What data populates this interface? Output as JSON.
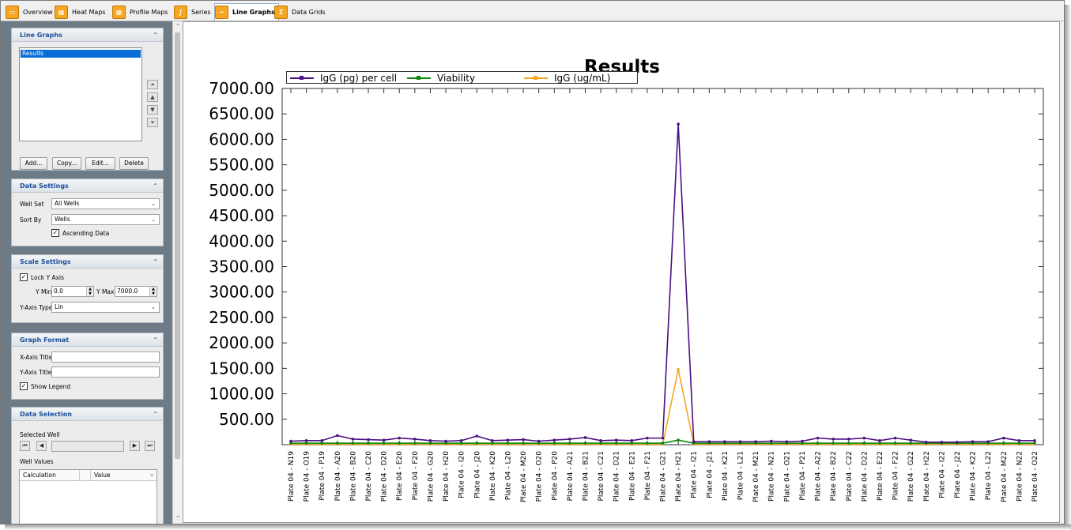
{
  "tabs": [
    {
      "id": "overview",
      "label": "Overview",
      "icon": "overview-icon",
      "glyph": "▭",
      "left": 6
    },
    {
      "id": "heat-maps",
      "label": "Heat Maps",
      "icon": "heat-map-icon",
      "glyph": "▦",
      "left": 68
    },
    {
      "id": "profile-maps",
      "label": "Profile Maps",
      "icon": "profile-map-icon",
      "glyph": "▦",
      "left": 141
    },
    {
      "id": "series",
      "label": "Series",
      "icon": "series-icon",
      "glyph": "∫",
      "left": 219
    },
    {
      "id": "line-graphs",
      "label": "Line Graphs",
      "icon": "line-graph-icon",
      "glyph": "~",
      "left": 270,
      "active": true
    },
    {
      "id": "data-grids",
      "label": "Data Grids",
      "icon": "data-grid-icon",
      "glyph": "Σ",
      "left": 346
    }
  ],
  "line_graphs": {
    "header": "Line Graphs",
    "items": [
      "Results"
    ],
    "add_label": "Add...",
    "copy_label": "Copy...",
    "edit_label": "Edit...",
    "delete_label": "Delete"
  },
  "data_settings": {
    "header": "Data Settings",
    "well_set_label": "Well Set",
    "well_set_value": "All Wells",
    "sort_by_label": "Sort By",
    "sort_by_value": "Wells",
    "ascending_label": "Ascending Data",
    "ascending_checked": true
  },
  "scale_settings": {
    "header": "Scale Settings",
    "lock_y_label": "Lock Y Axis",
    "lock_y_checked": true,
    "y_min_label": "Y Min",
    "y_min_value": "0.0",
    "y_max_label": "Y Max",
    "y_max_value": "7000.0",
    "y_axis_type_label": "Y-Axis Type",
    "y_axis_type_value": "Lin"
  },
  "graph_format": {
    "header": "Graph Format",
    "x_axis_title_label": "X-Axis Title",
    "x_axis_title_value": "",
    "y_axis_title_label": "Y-Axis Title",
    "y_axis_title_value": "",
    "show_legend_label": "Show Legend",
    "show_legend_checked": true
  },
  "data_selection": {
    "header": "Data Selection",
    "selected_well_label": "Selected Well",
    "selected_well_value": "",
    "well_values_label": "Well Values",
    "col_calculation": "Calculation",
    "col_value": "Value"
  },
  "colors": {
    "accent_orange": "#f6a623",
    "header_blue": "#1c4e9e",
    "igg_per_cell": "#4b0f82",
    "viability": "#0a8a0a",
    "igg_ugml": "#f5a623"
  },
  "chart_data": {
    "type": "line",
    "title": "Results",
    "xlabel": "",
    "ylabel": "",
    "ylim": [
      0,
      7000
    ],
    "yticks": [
      500,
      1000,
      1500,
      2000,
      2500,
      3000,
      3500,
      4000,
      4500,
      5000,
      5500,
      6000,
      6500,
      7000
    ],
    "ytick_labels": [
      "500.00",
      "1000.00",
      "1500.00",
      "2000.00",
      "2500.00",
      "3000.00",
      "3500.00",
      "4000.00",
      "4500.00",
      "5000.00",
      "5500.00",
      "6000.00",
      "6500.00",
      "7000.00"
    ],
    "legend_position": "top-left",
    "grid": false,
    "categories": [
      "Plate 04 - N19",
      "Plate 04 - O19",
      "Plate 04 - P19",
      "Plate 04 - A20",
      "Plate 04 - B20",
      "Plate 04 - C20",
      "Plate 04 - D20",
      "Plate 04 - E20",
      "Plate 04 - F20",
      "Plate 04 - G20",
      "Plate 04 - H20",
      "Plate 04 - I20",
      "Plate 04 - J20",
      "Plate 04 - K20",
      "Plate 04 - L20",
      "Plate 04 - M20",
      "Plate 04 - O20",
      "Plate 04 - P20",
      "Plate 04 - A21",
      "Plate 04 - B21",
      "Plate 04 - C21",
      "Plate 04 - D21",
      "Plate 04 - E21",
      "Plate 04 - F21",
      "Plate 04 - G21",
      "Plate 04 - H21",
      "Plate 04 - I21",
      "Plate 04 - J21",
      "Plate 04 - K21",
      "Plate 04 - L21",
      "Plate 04 - M21",
      "Plate 04 - N21",
      "Plate 04 - O21",
      "Plate 04 - P21",
      "Plate 04 - A22",
      "Plate 04 - B22",
      "Plate 04 - C22",
      "Plate 04 - D22",
      "Plate 04 - E22",
      "Plate 04 - F22",
      "Plate 04 - G22",
      "Plate 04 - H22",
      "Plate 04 - I22",
      "Plate 04 - J22",
      "Plate 04 - K22",
      "Plate 04 - L22",
      "Plate 04 - M22",
      "Plate 04 - N22",
      "Plate 04 - O22"
    ],
    "series": [
      {
        "name": "IgG (pg) per cell",
        "color": "#4b0f82",
        "values": [
          70,
          80,
          80,
          180,
          110,
          100,
          90,
          130,
          110,
          80,
          70,
          80,
          170,
          80,
          90,
          100,
          70,
          90,
          110,
          140,
          80,
          90,
          80,
          130,
          130,
          6300,
          60,
          60,
          60,
          60,
          60,
          70,
          60,
          70,
          130,
          110,
          110,
          130,
          80,
          130,
          90,
          50,
          50,
          50,
          60,
          60,
          130,
          80,
          80
        ]
      },
      {
        "name": "Viability",
        "color": "#0a8a0a",
        "values": [
          30,
          30,
          30,
          30,
          30,
          30,
          30,
          30,
          30,
          30,
          30,
          30,
          30,
          30,
          30,
          30,
          30,
          30,
          30,
          30,
          30,
          30,
          30,
          30,
          30,
          90,
          30,
          30,
          30,
          30,
          30,
          30,
          30,
          30,
          30,
          30,
          30,
          30,
          30,
          30,
          30,
          30,
          30,
          30,
          30,
          30,
          30,
          30,
          30
        ]
      },
      {
        "name": "IgG (ug/mL)",
        "color": "#f5a623",
        "values": [
          10,
          10,
          10,
          10,
          10,
          10,
          10,
          10,
          10,
          10,
          10,
          10,
          10,
          10,
          10,
          10,
          10,
          10,
          10,
          10,
          10,
          10,
          10,
          10,
          10,
          1480,
          10,
          10,
          10,
          10,
          10,
          10,
          10,
          10,
          10,
          10,
          10,
          10,
          10,
          10,
          10,
          10,
          10,
          10,
          10,
          10,
          10,
          10,
          10
        ]
      }
    ]
  }
}
